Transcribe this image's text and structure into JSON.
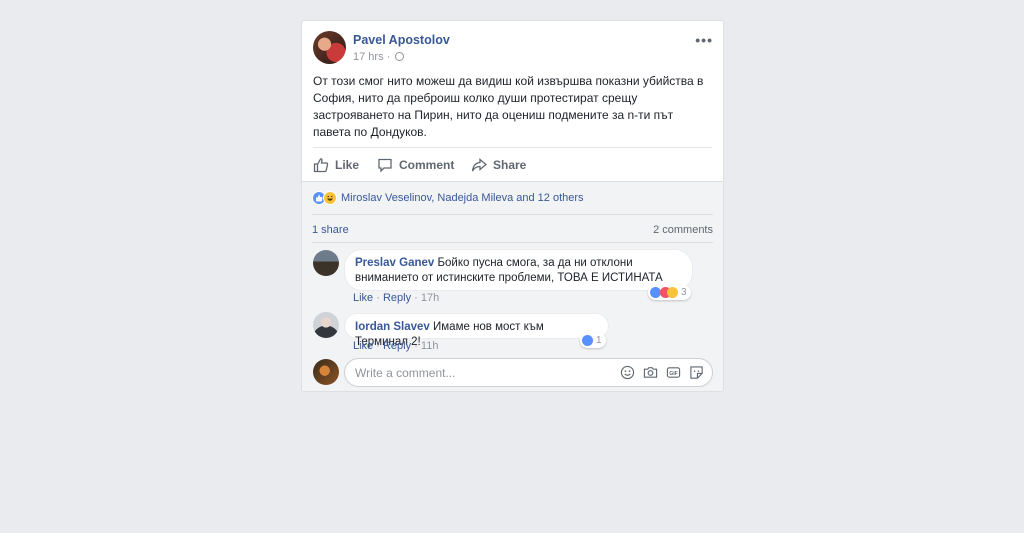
{
  "post": {
    "author": "Pavel Apostolov",
    "time": "17 hrs",
    "more": "•••",
    "text": "От този смог нито можеш да видиш кой извършва показни убийства в София, нито да преброиш колко души протестират срещу застрояването на Пирин, нито да оцениш подмените за n-ти път павета по Дондуков.",
    "actions": {
      "like": "Like",
      "comment": "Comment",
      "share": "Share"
    }
  },
  "engagement": {
    "reacted_by": "Miroslav Veselinov, Nadejda Mileva and 12 others",
    "shares": "1 share",
    "comments_count": "2 comments"
  },
  "comments": [
    {
      "author": "Preslav Ganev",
      "text": "Бойко пусна смога, за да ни отклони вниманието от истинските проблеми, ТОВА Е ИСТИНАТА",
      "like": "Like",
      "reply": "Reply",
      "sep": "·",
      "time": "17h",
      "reaction_count": "3"
    },
    {
      "author": "Iordan Slavev",
      "text": "Имаме нов мост към Терминал 2!",
      "like": "Like",
      "reply": "Reply",
      "sep": "·",
      "time": "11h",
      "reaction_count": "1"
    }
  ],
  "write_comment": {
    "placeholder": "Write a comment..."
  },
  "colors": {
    "link": "#385898",
    "background": "#e9ebee",
    "like_blue": "#5890ff"
  }
}
